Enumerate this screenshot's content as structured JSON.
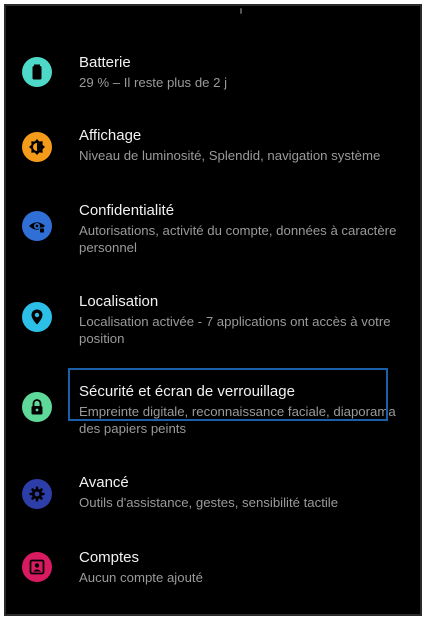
{
  "settings": {
    "items": [
      {
        "title": "Batterie",
        "subtitle": "29 % – Il reste plus de 2 j",
        "icon": "battery-icon",
        "color": "#4ed8c8"
      },
      {
        "title": "Affichage",
        "subtitle": "Niveau de luminosité, Splendid, navigation système",
        "icon": "brightness-icon",
        "color": "#f59b1a"
      },
      {
        "title": "Confidentialité",
        "subtitle": "Autorisations, activité du compte, données à caractère personnel",
        "icon": "privacy-eye-icon",
        "color": "#2f6fd6"
      },
      {
        "title": "Localisation",
        "subtitle": "Localisation activée - 7 applications ont accès à votre position",
        "icon": "location-pin-icon",
        "color": "#2cc0e8"
      },
      {
        "title": "Sécurité et écran de verrouillage",
        "subtitle": "Empreinte digitale, reconnaissance faciale, diaporama des papiers peints",
        "icon": "lock-icon",
        "color": "#5fd99a"
      },
      {
        "title": "Avancé",
        "subtitle": "Outils d'assistance, gestes, sensibilité tactile",
        "icon": "gear-icon",
        "color": "#2d3ea8"
      },
      {
        "title": "Comptes",
        "subtitle": "Aucun compte ajouté",
        "icon": "account-icon",
        "color": "#d81b60"
      }
    ]
  }
}
